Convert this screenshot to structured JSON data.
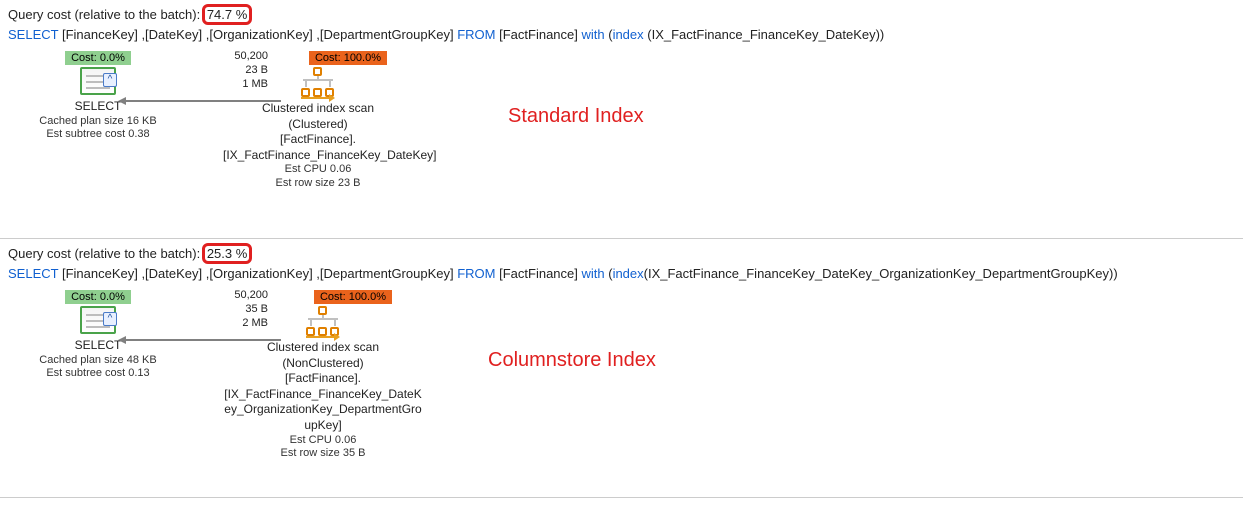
{
  "plans": [
    {
      "cost_prefix": "Query cost (relative to the batch):",
      "cost_value": "74.7 %",
      "sql": {
        "p1": "SELECT",
        "p2": " [FinanceKey] ,[DateKey] ,[OrganizationKey] ,[DepartmentGroupKey] ",
        "p3": "FROM",
        "p4": " [FactFinance] ",
        "p5": "with",
        "p6": " (",
        "p7": "index",
        "p8": " (IX_FactFinance_FinanceKey_DateKey))"
      },
      "annotation": "Standard Index",
      "select": {
        "cost": "Cost: 0.0%",
        "label": "SELECT",
        "m1": "Cached plan size  16 KB",
        "m2": "Est subtree cost  0.38"
      },
      "edge": {
        "rows": "50,200",
        "bytes": "23 B",
        "size": "1 MB"
      },
      "scan": {
        "cost": "Cost: 100.0%",
        "l1": "Clustered index scan",
        "l2": "(Clustered)",
        "l3": "[FactFinance].",
        "l4": "[IX_FactFinance_FinanceKey_DateKey]",
        "m1": "Est CPU  0.06",
        "m2": "Est row size  23 B"
      }
    },
    {
      "cost_prefix": "Query cost (relative to the batch):",
      "cost_value": "25.3 %",
      "sql": {
        "p1": "SELECT",
        "p2": " [FinanceKey] ,[DateKey] ,[OrganizationKey] ,[DepartmentGroupKey] ",
        "p3": "FROM",
        "p4": " [FactFinance] ",
        "p5": "with",
        "p6": " (",
        "p7": "index",
        "p8": "(IX_FactFinance_FinanceKey_DateKey_OrganizationKey_DepartmentGroupKey))"
      },
      "annotation": "Columnstore Index",
      "select": {
        "cost": "Cost: 0.0%",
        "label": "SELECT",
        "m1": "Cached plan size  48 KB",
        "m2": "Est subtree cost  0.13"
      },
      "edge": {
        "rows": "50,200",
        "bytes": "35 B",
        "size": "2 MB"
      },
      "scan": {
        "cost": "Cost: 100.0%",
        "l1": "Clustered index scan",
        "l2": "(NonClustered)",
        "l3": "[FactFinance].",
        "l4": "[IX_FactFinance_FinanceKey_DateKey_OrganizationKey_DepartmentGroupKey]",
        "m1": "Est CPU  0.06",
        "m2": "Est row size  35 B"
      }
    }
  ]
}
